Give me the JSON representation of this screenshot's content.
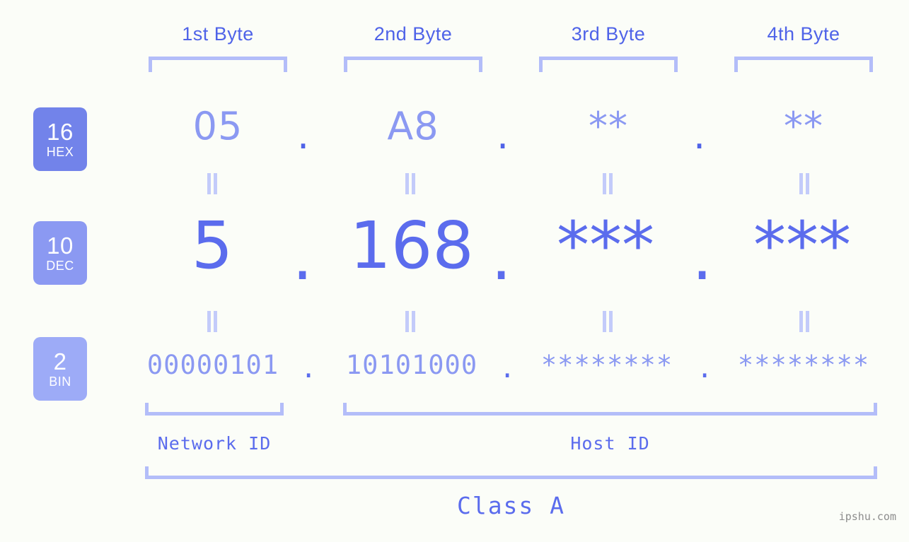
{
  "background": "#fbfdf8",
  "accent": "#5b6ced",
  "accent_light": "#8b99f2",
  "bracket_color": "#b3bdf9",
  "byte_headers": [
    {
      "label": "1st Byte"
    },
    {
      "label": "2nd Byte"
    },
    {
      "label": "3rd Byte"
    },
    {
      "label": "4th Byte"
    }
  ],
  "bases": [
    {
      "num": "16",
      "name": "HEX",
      "color": "#7283ea"
    },
    {
      "num": "10",
      "name": "DEC",
      "color": "#8b99f2"
    },
    {
      "num": "2",
      "name": "BIN",
      "color": "#9dabf7"
    }
  ],
  "rows": {
    "hex": {
      "base_num": "16",
      "base_name": "HEX",
      "values": [
        "05",
        "A8",
        "**",
        "**"
      ],
      "separators": [
        ".",
        ".",
        "."
      ]
    },
    "dec": {
      "base_num": "10",
      "base_name": "DEC",
      "values": [
        "5",
        "168",
        "***",
        "***"
      ],
      "separators": [
        ".",
        ".",
        "."
      ]
    },
    "bin": {
      "base_num": "2",
      "base_name": "BIN",
      "values": [
        "00000101",
        "10101000",
        "********",
        "********"
      ],
      "separators": [
        ".",
        ".",
        "."
      ]
    }
  },
  "equals_marks": {
    "glyph": "||",
    "count_per_gap": 4,
    "gaps": 2
  },
  "footer": {
    "network_id_label": "Network ID",
    "host_id_label": "Host ID",
    "class_label": "Class A"
  },
  "watermark": "ipshu.com"
}
